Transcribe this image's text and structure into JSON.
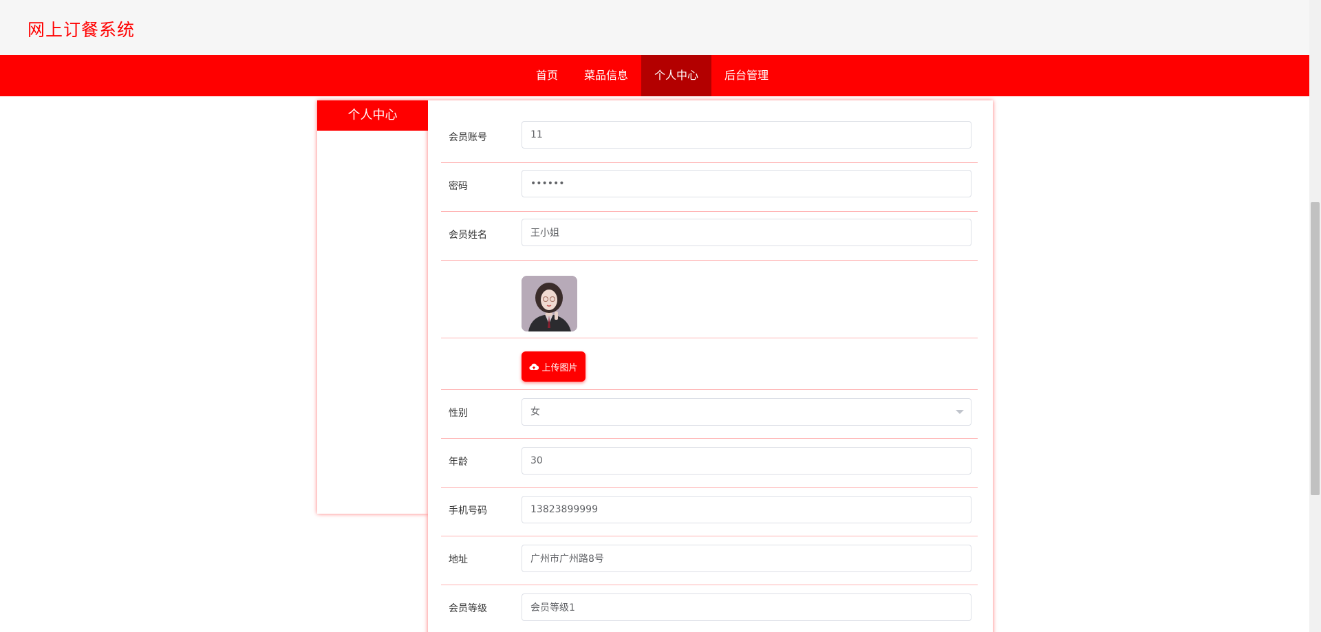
{
  "header": {
    "site_title": "网上订餐系统"
  },
  "nav": {
    "items": [
      {
        "label": "首页"
      },
      {
        "label": "菜品信息"
      },
      {
        "label": "个人中心",
        "active": true
      },
      {
        "label": "后台管理"
      }
    ]
  },
  "sidebar": {
    "title": "个人中心"
  },
  "form": {
    "account": {
      "label": "会员账号",
      "value": "11"
    },
    "password": {
      "label": "密码",
      "value": "••••••"
    },
    "name": {
      "label": "会员姓名",
      "value": "王小姐"
    },
    "upload": {
      "label": "上传图片",
      "icon": "cloud-upload-icon"
    },
    "gender": {
      "label": "性别",
      "value": "女"
    },
    "age": {
      "label": "年龄",
      "value": "30"
    },
    "phone": {
      "label": "手机号码",
      "value": "13823899999"
    },
    "address": {
      "label": "地址",
      "value": "广州市广州路8号"
    },
    "level": {
      "label": "会员等级",
      "value": "会员等级1"
    }
  },
  "colors": {
    "primary": "#ff0000",
    "active_nav": "#b30000",
    "row_divider": "#ffb3b3"
  }
}
